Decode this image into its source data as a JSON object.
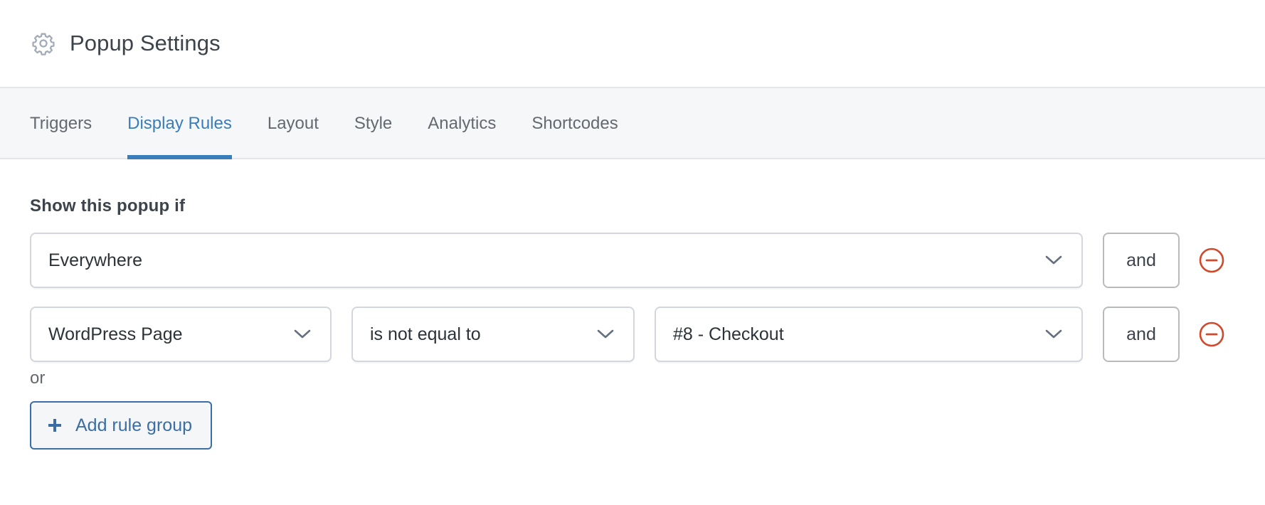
{
  "header": {
    "icon": "gear-icon",
    "title": "Popup Settings"
  },
  "tabs": [
    {
      "label": "Triggers",
      "active": false
    },
    {
      "label": "Display Rules",
      "active": true
    },
    {
      "label": "Layout",
      "active": false
    },
    {
      "label": "Style",
      "active": false
    },
    {
      "label": "Analytics",
      "active": false
    },
    {
      "label": "Shortcodes",
      "active": false
    }
  ],
  "colors": {
    "accent": "#3a7dbb",
    "remove": "#d0492a",
    "tab_bar_bg": "#f6f7f9"
  },
  "display_rules": {
    "heading": "Show this popup if",
    "rules": [
      {
        "location": "Everywhere",
        "connector": "and",
        "remove_icon": "minus-circle-icon"
      },
      {
        "location": "WordPress Page",
        "operator": "is not equal to",
        "value": "#8 - Checkout",
        "connector": "and",
        "remove_icon": "minus-circle-icon"
      }
    ],
    "or_label": "or",
    "add_group": {
      "icon": "plus-icon",
      "label": "Add rule group"
    }
  }
}
